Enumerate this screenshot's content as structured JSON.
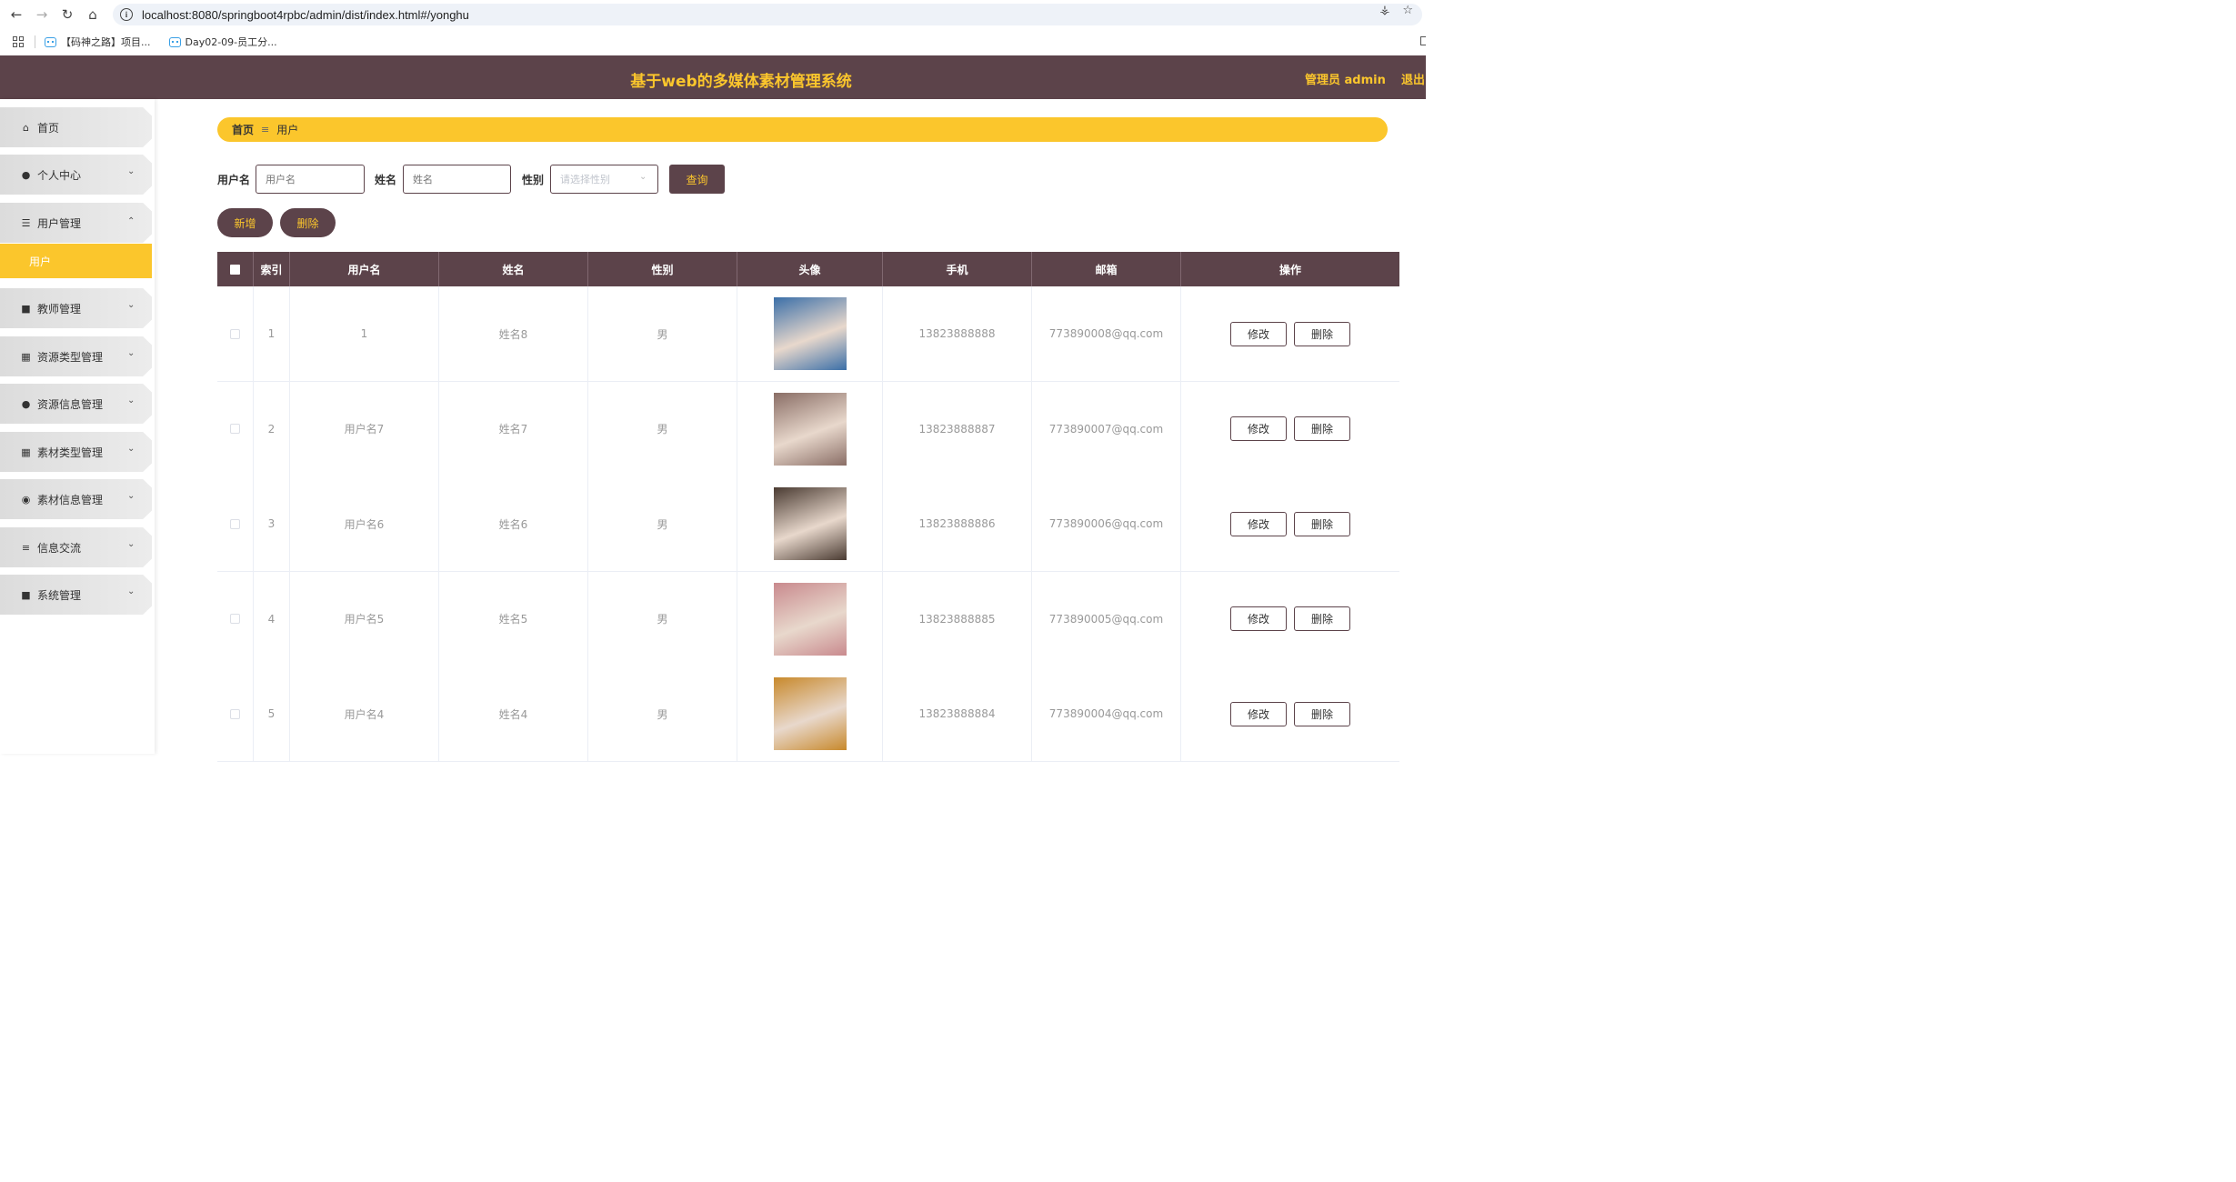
{
  "browser": {
    "url": "localhost:8080/springboot4rpbc/admin/dist/index.html#/yonghu",
    "bookmarks": [
      "【码神之路】项目...",
      "Day02-09-员工分..."
    ]
  },
  "header": {
    "title": "基于web的多媒体素材管理系统",
    "admin": "管理员 admin",
    "logout": "退出"
  },
  "sidebar": {
    "items": [
      {
        "label": "首页",
        "icon": "home-icon"
      },
      {
        "label": "个人中心",
        "icon": "user-icon"
      },
      {
        "label": "用户管理",
        "icon": "list-icon"
      },
      {
        "label": "教师管理",
        "icon": "clipboard-icon"
      },
      {
        "label": "资源类型管理",
        "icon": "chart-icon"
      },
      {
        "label": "资源信息管理",
        "icon": "user-icon"
      },
      {
        "label": "素材类型管理",
        "icon": "grid-icon"
      },
      {
        "label": "素材信息管理",
        "icon": "palette-icon"
      },
      {
        "label": "信息交流",
        "icon": "sliders-icon"
      },
      {
        "label": "系统管理",
        "icon": "clipboard-icon"
      }
    ],
    "sub_active": "用户"
  },
  "breadcrumb": {
    "home": "首页",
    "current": "用户"
  },
  "search": {
    "username_label": "用户名",
    "username_placeholder": "用户名",
    "name_label": "姓名",
    "name_placeholder": "姓名",
    "gender_label": "性别",
    "gender_placeholder": "请选择性别",
    "query_label": "查询"
  },
  "actions": {
    "add": "新增",
    "delete": "删除"
  },
  "table": {
    "headers": [
      "索引",
      "用户名",
      "姓名",
      "性别",
      "头像",
      "手机",
      "邮箱",
      "操作"
    ],
    "edit_label": "修改",
    "delete_label": "删除",
    "rows": [
      {
        "index": "1",
        "username": "1",
        "name": "姓名8",
        "gender": "男",
        "phone": "13823888888",
        "email": "773890008@qq.com",
        "avatar_color": "#3b6fa8"
      },
      {
        "index": "2",
        "username": "用户名7",
        "name": "姓名7",
        "gender": "男",
        "phone": "13823888887",
        "email": "773890007@qq.com",
        "avatar_color": "#8a6e66"
      },
      {
        "index": "3",
        "username": "用户名6",
        "name": "姓名6",
        "gender": "男",
        "phone": "13823888886",
        "email": "773890006@qq.com",
        "avatar_color": "#4a3b32"
      },
      {
        "index": "4",
        "username": "用户名5",
        "name": "姓名5",
        "gender": "男",
        "phone": "13823888885",
        "email": "773890005@qq.com",
        "avatar_color": "#c98a8e"
      },
      {
        "index": "5",
        "username": "用户名4",
        "name": "姓名4",
        "gender": "男",
        "phone": "13823888884",
        "email": "773890004@qq.com",
        "avatar_color": "#c8892c"
      }
    ]
  }
}
